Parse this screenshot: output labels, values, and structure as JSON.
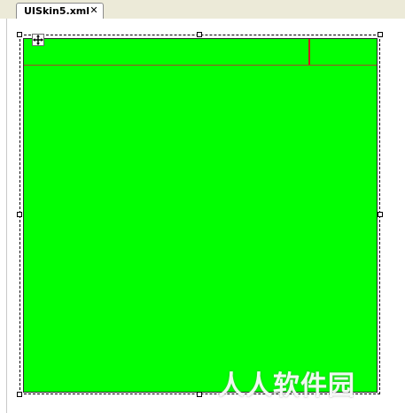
{
  "tabs": [
    {
      "label": "UISkin5.xml",
      "close_glyph": "✕"
    }
  ],
  "design_surface": {
    "background_color": "#00ff00",
    "guide_line_colors": [
      "#a04a2a",
      "#c81e1e"
    ],
    "move_icon": "move-arrows-icon"
  },
  "watermark": {
    "text": "人人软件园"
  }
}
